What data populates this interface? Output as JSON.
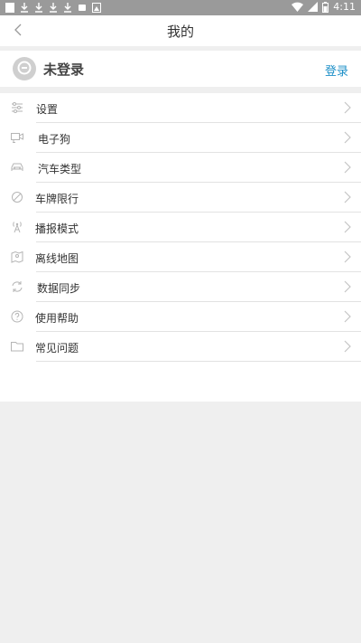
{
  "status_bar": {
    "time": "4:11",
    "notification_icons": [
      "square-icon",
      "download-icon",
      "download-icon",
      "download-icon",
      "download-icon",
      "sd-card-icon",
      "image-icon"
    ],
    "right_icons": [
      "wifi-icon",
      "signal-icon",
      "battery-icon"
    ]
  },
  "header": {
    "title": "我的"
  },
  "profile": {
    "status": "未登录",
    "login_label": "登录"
  },
  "menu": [
    {
      "label": "设置",
      "icon": "settings-sliders-icon"
    },
    {
      "label": "电子狗",
      "icon": "dashcam-icon"
    },
    {
      "label": "汽车类型",
      "icon": "car-icon"
    },
    {
      "label": "车牌限行",
      "icon": "restriction-icon"
    },
    {
      "label": "播报模式",
      "icon": "broadcast-icon"
    },
    {
      "label": "离线地图",
      "icon": "offline-map-icon"
    },
    {
      "label": "数据同步",
      "icon": "sync-icon"
    },
    {
      "label": "使用帮助",
      "icon": "help-icon"
    },
    {
      "label": "常见问题",
      "icon": "faq-book-icon"
    }
  ],
  "colors": {
    "accent": "#1e90c8",
    "background": "#efefef",
    "statusbar": "#9a9a9a"
  }
}
